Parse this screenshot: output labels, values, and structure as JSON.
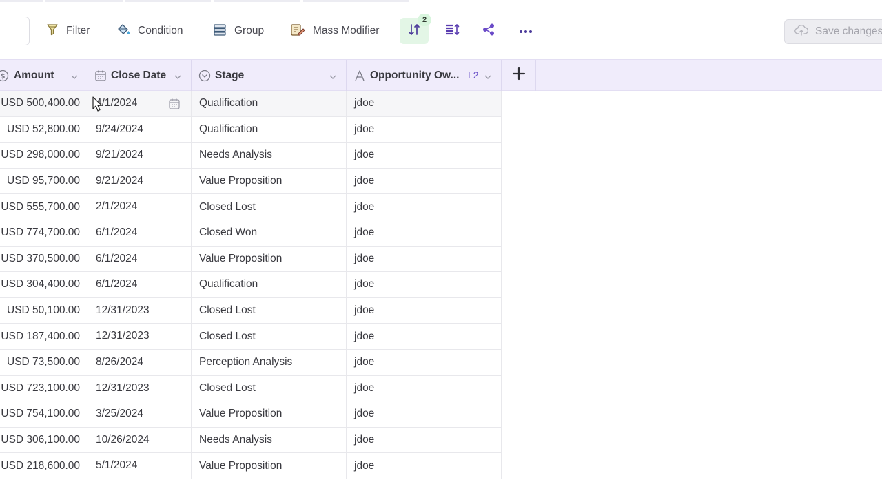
{
  "toolbar": {
    "filter_label": "Filter",
    "condition_label": "Condition",
    "group_label": "Group",
    "mass_modifier_label": "Mass Modifier",
    "sort_badge": "2",
    "save_label": "Save changes"
  },
  "columns": {
    "amount": "Amount",
    "close_date": "Close Date",
    "stage": "Stage",
    "owner": "Opportunity Ow...",
    "owner_level": "L2"
  },
  "rows": [
    {
      "amount": "USD 500,400.00",
      "close_date": "4/1/2024",
      "stage": "Qualification",
      "owner": "jdoe"
    },
    {
      "amount": "USD 52,800.00",
      "close_date": "9/24/2024",
      "stage": "Qualification",
      "owner": "jdoe"
    },
    {
      "amount": "USD 298,000.00",
      "close_date": "9/21/2024",
      "stage": "Needs Analysis",
      "owner": "jdoe"
    },
    {
      "amount": "USD 95,700.00",
      "close_date": "9/21/2024",
      "stage": "Value Proposition",
      "owner": "jdoe"
    },
    {
      "amount": "USD 555,700.00",
      "close_date": "2/1/2024",
      "stage": "Closed Lost",
      "owner": "jdoe"
    },
    {
      "amount": "USD 774,700.00",
      "close_date": "6/1/2024",
      "stage": "Closed Won",
      "owner": "jdoe"
    },
    {
      "amount": "USD 370,500.00",
      "close_date": "6/1/2024",
      "stage": "Value Proposition",
      "owner": "jdoe"
    },
    {
      "amount": "USD 304,400.00",
      "close_date": "6/1/2024",
      "stage": "Qualification",
      "owner": "jdoe"
    },
    {
      "amount": "USD 50,100.00",
      "close_date": "12/31/2023",
      "stage": "Closed Lost",
      "owner": "jdoe"
    },
    {
      "amount": "USD 187,400.00",
      "close_date": "12/31/2023",
      "stage": "Closed Lost",
      "owner": "jdoe"
    },
    {
      "amount": "USD 73,500.00",
      "close_date": "8/26/2024",
      "stage": "Perception Analysis",
      "owner": "jdoe"
    },
    {
      "amount": "USD 723,100.00",
      "close_date": "12/31/2023",
      "stage": "Closed Lost",
      "owner": "jdoe"
    },
    {
      "amount": "USD 754,100.00",
      "close_date": "3/25/2024",
      "stage": "Value Proposition",
      "owner": "jdoe"
    },
    {
      "amount": "USD 306,100.00",
      "close_date": "10/26/2024",
      "stage": "Needs Analysis",
      "owner": "jdoe"
    },
    {
      "amount": "USD 218,600.00",
      "close_date": "5/1/2024",
      "stage": "Value Proposition",
      "owner": "jdoe"
    }
  ],
  "colors": {
    "accent": "#6b52c8",
    "header_band": "#f0ecfb",
    "sort_active": "#e3f6e6"
  },
  "icons": {
    "filter": "filter-funnel-icon",
    "condition": "paint-bucket-icon",
    "group": "stacked-layers-icon",
    "mass_modifier": "edit-list-icon",
    "sort": "sort-arrows-icon",
    "row_height": "row-height-icon",
    "share": "share-icon",
    "more": "more-dots-icon",
    "save": "cloud-upload-icon"
  }
}
